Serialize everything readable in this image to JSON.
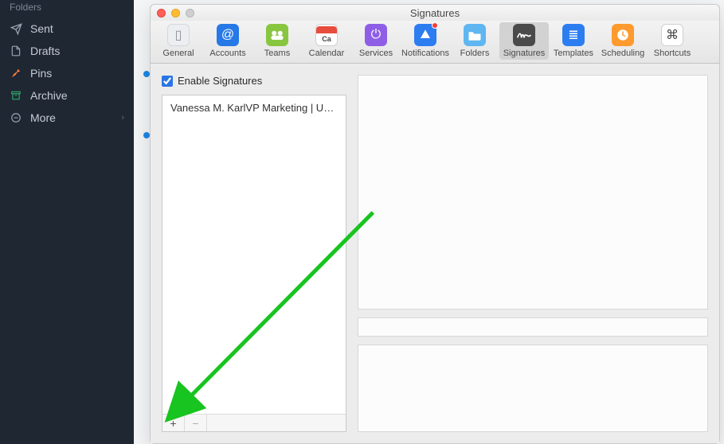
{
  "sidebar": {
    "header": "Folders",
    "items": [
      {
        "label": "Sent",
        "icon": "send-icon",
        "glyph": "✈"
      },
      {
        "label": "Drafts",
        "icon": "draft-icon",
        "glyph": "📄"
      },
      {
        "label": "Pins",
        "icon": "pin-icon",
        "glyph": "📌",
        "color": "#ff7b3d"
      },
      {
        "label": "Archive",
        "icon": "archive-icon",
        "glyph": "🗄",
        "color": "#2fa66a"
      },
      {
        "label": "More",
        "icon": "more-icon",
        "glyph": "⊖",
        "chevron": true
      }
    ]
  },
  "window": {
    "title": "Signatures",
    "toolbar": [
      {
        "label": "General",
        "name": "tab-general",
        "icon": "phone-icon",
        "cls": "tb-general",
        "glyph": "▯"
      },
      {
        "label": "Accounts",
        "name": "tab-accounts",
        "icon": "at-icon",
        "cls": "tb-accounts",
        "glyph": "@"
      },
      {
        "label": "Teams",
        "name": "tab-teams",
        "icon": "people-icon",
        "cls": "tb-teams",
        "glyph": "⚇"
      },
      {
        "label": "Calendar",
        "name": "tab-calendar",
        "icon": "calendar-icon",
        "cls": "tb-calendar",
        "glyph": "Ca"
      },
      {
        "label": "Services",
        "name": "tab-services",
        "icon": "power-icon",
        "cls": "tb-services",
        "glyph": "⏻"
      },
      {
        "label": "Notifications",
        "name": "tab-notifications",
        "icon": "app-icon",
        "cls": "tb-notifications",
        "glyph": "✈"
      },
      {
        "label": "Folders",
        "name": "tab-folders",
        "icon": "folder-icon",
        "cls": "tb-folders",
        "glyph": "▭"
      },
      {
        "label": "Signatures",
        "name": "tab-signatures",
        "icon": "signature-icon",
        "cls": "tb-signatures",
        "glyph": "✎",
        "selected": true
      },
      {
        "label": "Templates",
        "name": "tab-templates",
        "icon": "templates-icon",
        "cls": "tb-templates",
        "glyph": "≣"
      },
      {
        "label": "Scheduling",
        "name": "tab-scheduling",
        "icon": "clock-icon",
        "cls": "tb-scheduling",
        "glyph": "◷"
      },
      {
        "label": "Shortcuts",
        "name": "tab-shortcuts",
        "icon": "command-icon",
        "cls": "tb-shortcuts",
        "glyph": "⌘"
      }
    ],
    "enable_signatures_label": "Enable Signatures",
    "enable_signatures_checked": true,
    "signatures": [
      {
        "display": "Vanessa M. KarlVP Marketing | U…"
      }
    ],
    "add_button": "+",
    "remove_button": "−",
    "calendar_badge": "Ca"
  }
}
